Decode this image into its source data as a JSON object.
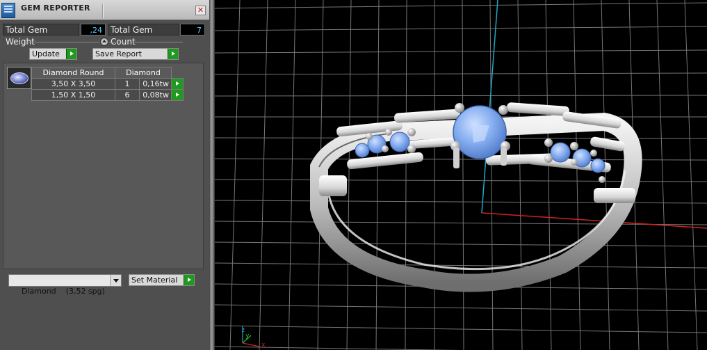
{
  "window": {
    "title": "GEM REPORTER",
    "close_glyph": "✕",
    "icon": "gem-reporter-app-icon"
  },
  "stats": {
    "total_weight_label": "Total Gem Weight",
    "total_weight_value": ",24",
    "total_count_label": "Total Gem Count",
    "total_count_value": "7"
  },
  "actions": {
    "update_label": "Update",
    "save_report_label": "Save Report"
  },
  "gem_table": {
    "headers": [
      "Diamond Round",
      "Diamond"
    ],
    "rows": [
      {
        "size": "3,50 X 3,50",
        "count": "1",
        "weight": "0,16tw"
      },
      {
        "size": "1,50 X 1,50",
        "count": "6",
        "weight": "0,08tw"
      }
    ]
  },
  "material": {
    "selected": "Diamond    (3,52 spg)",
    "set_material_label": "Set Material"
  },
  "viewport": {
    "axis_x": "x",
    "axis_y": "y",
    "axis_z": "z",
    "colors": {
      "grid": "#8a8a8a",
      "x_axis": "#d42020",
      "z_axis": "#20a8c8",
      "gem": "#7fa8e8",
      "metal": "#dcdcdc"
    }
  }
}
